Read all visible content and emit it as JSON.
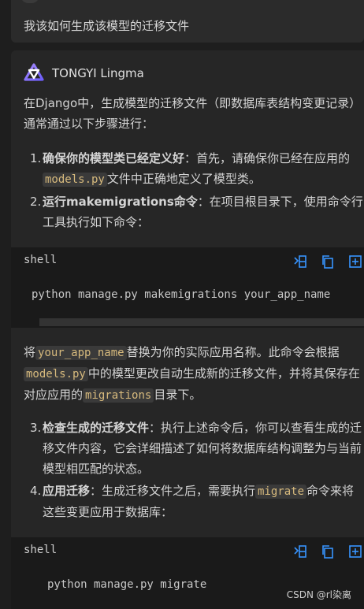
{
  "user_message": {
    "text": "我该如何生成该模型的迁移文件"
  },
  "reply": {
    "author": "TONGYI Lingma",
    "intro": "在Django中，生成模型的迁移文件（即数据库表结构变更记录）通常通过以下步骤进行：",
    "steps_1": [
      {
        "num": "1.",
        "bold": "确保你的模型类已经定义好",
        "pre": "：首先，请确保你已经在应用的",
        "code": "models.py",
        "post": "文件中正确地定义了模型类。"
      },
      {
        "num": "2.",
        "bold": "运行makemigrations命令",
        "pre": "：在项目根目录下，使用命令行工具执行如下命令："
      }
    ],
    "code_block_1": {
      "lang": "shell",
      "code": "python manage.py makemigrations your_app_name"
    },
    "middle": {
      "t1": "将",
      "c1": "your_app_name",
      "t2": "替换为你的实际应用名称。此命令会根据",
      "c2": "models.py",
      "t3": "中的模型更改自动生成新的迁移文件，并将其保存在对应应用的",
      "c3": "migrations",
      "t4": "目录下。"
    },
    "steps_2": [
      {
        "num": "3.",
        "bold": "检查生成的迁移文件",
        "pre": "：执行上述命令后，你可以查看生成的迁移文件内容，它会详细描述了如何将数据库结构调整为与当前模型相匹配的状态。"
      },
      {
        "num": "4.",
        "bold": "应用迁移",
        "pre": "：生成迁移文件之后，需要执行",
        "code": "migrate",
        "post": "命令来将这些变更应用于数据库："
      }
    ],
    "code_block_2": {
      "lang": "shell",
      "code": "python manage.py migrate"
    }
  },
  "icons": {
    "insert": "insert-at-cursor-icon",
    "copy": "copy-icon",
    "new_file": "new-file-icon"
  },
  "watermark": "CSDN @rl染离",
  "colors": {
    "accent": "#3794ff",
    "inline_code": "#d7ba7d",
    "background": "#1e1e1e"
  }
}
